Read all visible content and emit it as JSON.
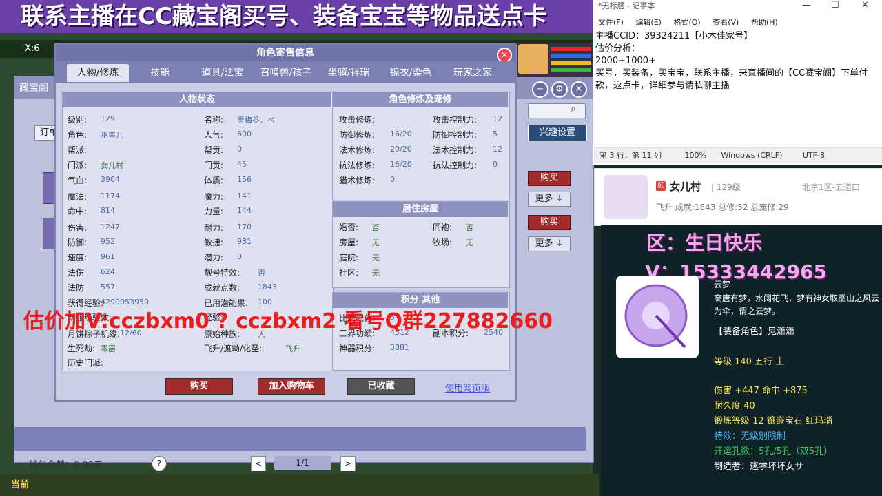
{
  "banner": {
    "text": "联系主播在CC藏宝阁买号、装备宝宝等物品送点卡"
  },
  "game_hud": {
    "coord": "X:6"
  },
  "store": {
    "title": "藏宝阁",
    "order_label": "订单",
    "interest_btn": "兴趣设置",
    "side_buttons": [
      {
        "buy": "购买",
        "more": "更多 ↓"
      },
      {
        "buy": "购买",
        "more": "更多 ↓"
      }
    ],
    "wallet": "钱包余额：0.00元",
    "help": "?",
    "pager": {
      "prev": "<",
      "page": "1/1",
      "next": ">"
    }
  },
  "taskbar": {
    "current": "当前"
  },
  "modal": {
    "title": "角色寄售信息",
    "close": "✕",
    "tabs": [
      {
        "label": "人物/修炼",
        "active": true
      },
      {
        "label": "技能",
        "active": false
      },
      {
        "label": "道具/法宝",
        "active": false
      },
      {
        "label": "召唤兽/孩子",
        "active": false
      },
      {
        "label": "坐骑/祥瑞",
        "active": false
      },
      {
        "label": "锦衣/染色",
        "active": false
      },
      {
        "label": "玩家之家",
        "active": false
      }
    ],
    "char_status": {
      "title": "人物状态",
      "left": [
        {
          "label": "级别:",
          "value": "129"
        },
        {
          "label": "角色:",
          "value": "巫蛮儿"
        },
        {
          "label": "帮派:",
          "value": ""
        },
        {
          "label": "门派:",
          "value": "女儿村"
        },
        {
          "label": "气血:",
          "value": "3904"
        },
        {
          "label": "魔法:",
          "value": "1174"
        },
        {
          "label": "命中:",
          "value": "814"
        },
        {
          "label": "伤害:",
          "value": "1247"
        },
        {
          "label": "防御:",
          "value": "952"
        },
        {
          "label": "速度:",
          "value": "961"
        },
        {
          "label": "法伤",
          "value": "624"
        },
        {
          "label": "法防",
          "value": "557"
        },
        {
          "label": "获得经验:",
          "value": "4290053950"
        },
        {
          "label": "新服经验数:",
          "value": ""
        },
        {
          "label": "月饼粽子机缘:",
          "value": "12/60"
        },
        {
          "label": "生死劫:",
          "value": "零层"
        },
        {
          "label": "历史门派:",
          "value": ""
        }
      ],
      "right": [
        {
          "label": "名称:",
          "value": "雪梅香．ぺ"
        },
        {
          "label": "人气:",
          "value": "600"
        },
        {
          "label": "帮贡:",
          "value": "0"
        },
        {
          "label": "门贡:",
          "value": "45"
        },
        {
          "label": "体质:",
          "value": "156"
        },
        {
          "label": "魔力:",
          "value": "141"
        },
        {
          "label": "力量:",
          "value": "144"
        },
        {
          "label": "耐力:",
          "value": "170"
        },
        {
          "label": "敏捷:",
          "value": "981"
        },
        {
          "label": "潜力:",
          "value": "0"
        },
        {
          "label": "靓号特效:",
          "value": "否"
        },
        {
          "label": "成就点数:",
          "value": "1843"
        },
        {
          "label": "已用潜能果:",
          "value": "100"
        },
        {
          "label": "经验:",
          "value": ""
        },
        {
          "label": "原始种族:",
          "value": "人"
        },
        {
          "label": "飞升/渡劫/化圣:",
          "value": "飞升"
        }
      ]
    },
    "cultivation": {
      "title": "角色修炼及宠修",
      "left": [
        {
          "label": "攻击修炼:",
          "value": ""
        },
        {
          "label": "防御修炼:",
          "value": "16/20"
        },
        {
          "label": "法术修炼:",
          "value": "20/20"
        },
        {
          "label": "抗法修炼:",
          "value": "16/20"
        },
        {
          "label": "猎术修炼:",
          "value": "0"
        }
      ],
      "right": [
        {
          "label": "攻击控制力:",
          "value": "12"
        },
        {
          "label": "防御控制力:",
          "value": "5"
        },
        {
          "label": "法术控制力:",
          "value": "12"
        },
        {
          "label": "抗法控制力:",
          "value": "0"
        }
      ]
    },
    "residence": {
      "title": "居住房屋",
      "left": [
        {
          "label": "婚否:",
          "value": "否"
        },
        {
          "label": "房屋:",
          "value": "无"
        },
        {
          "label": "庭院:",
          "value": "无"
        },
        {
          "label": "社区:",
          "value": "无"
        }
      ],
      "right": [
        {
          "label": "同袍:",
          "value": "否"
        },
        {
          "label": "牧场:",
          "value": "无"
        }
      ]
    },
    "points": {
      "title": "积分 其他",
      "left": [
        {
          "label": "比武积分:",
          "value": "54"
        },
        {
          "label": "三界功绩:",
          "value": "4512"
        },
        {
          "label": "神器积分:",
          "value": "3881"
        }
      ],
      "right": [
        {
          "label": "副本积分:",
          "value": "2540"
        }
      ]
    },
    "buttons": {
      "buy": "购买",
      "cart": "加入购物车",
      "fav": "已收藏",
      "web": "使用网页版"
    }
  },
  "overlay": {
    "estimate": "估价加V:cczbxm0  ? cczbxm2  看号Q群227882660"
  },
  "notepad": {
    "title": "*无标题 - 记事本",
    "menu": [
      "文件(F)",
      "编辑(E)",
      "格式(O)",
      "查看(V)",
      "帮助(H)"
    ],
    "lines": [
      "主播CCID：39324211【小木佳家号】",
      "估价分析：",
      "2000+1000+",
      "买号，买装备，买宝宝，联系主播，来直播间的【CC藏宝阁】下单付款，返点卡，详细参与请私聊主播"
    ],
    "status": {
      "pos": "第 3 行，第 11 列",
      "zoom": "100%",
      "eol": "Windows (CRLF)",
      "enc": "UTF-8"
    }
  },
  "card": {
    "tag": "区",
    "name": "女儿村",
    "level": "| 129级",
    "server": "北京1区-五道口",
    "stats": "飞升  成就:1843  总修:52  总宠修:29"
  },
  "item": {
    "pink1": "区：生日快乐",
    "pink2": "V：15333442965",
    "name": "云梦",
    "desc": "高唐有梦，水阔花飞，梦有神女取巫山之风云为伞，谓之云梦。",
    "equip_role": "【装备角色】鬼潇潇",
    "level_line": "等级 140  五行 土",
    "stat_line": "伤害 +447  命中 +875",
    "durability": "耐久度 40",
    "forge": "锻炼等级 12  镶嵌宝石 红玛瑙",
    "special": "特效：无级别限制",
    "holes": "开运孔数：5孔/5孔（双5孔）",
    "maker": "制造者：逃学坏坏女サ"
  }
}
